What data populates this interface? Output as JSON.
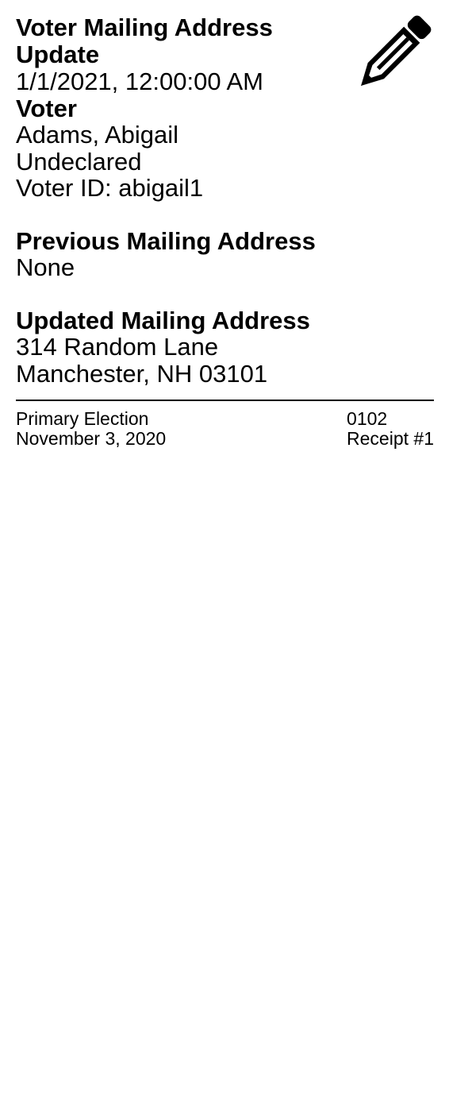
{
  "receipt": {
    "title": "Voter Mailing Address Update",
    "timestamp": "1/1/2021, 12:00:00 AM",
    "voter_heading": "Voter",
    "voter_name": "Adams, Abigail",
    "voter_party": "Undeclared",
    "voter_id": "Voter ID: abigail1",
    "previous_heading": "Previous Mailing Address",
    "previous_value": "None",
    "updated_heading": "Updated Mailing Address",
    "updated_line1": "314 Random Lane",
    "updated_line2": "Manchester, NH 03101",
    "icon": "pencil-icon"
  },
  "footer": {
    "election_name": "Primary Election",
    "election_date": "November 3, 2020",
    "precinct_code": "0102",
    "receipt_number": "Receipt #1"
  }
}
